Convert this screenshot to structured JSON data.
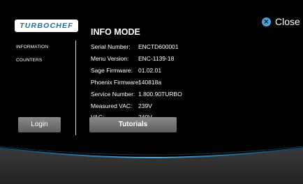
{
  "brand": {
    "logo_text": "TURBOCHEF",
    "accent": "#4aa3d8",
    "logo_color": "#1b6ea3"
  },
  "close": {
    "label": "Close",
    "icon": "close-icon"
  },
  "title": "INFO MODE",
  "sidebar": {
    "items": [
      {
        "label": "INFORMATION"
      },
      {
        "label": "COUNTERS"
      }
    ],
    "login_label": "Login"
  },
  "info": [
    {
      "key": "Serial Number:",
      "value": "ENCTD600001"
    },
    {
      "key": "Menu Version:",
      "value": "ENC-1139-18"
    },
    {
      "key": "Sage Firmware:",
      "value": "01.02.01"
    },
    {
      "key": "Phoenix Firmware:",
      "value": "140818a"
    },
    {
      "key": "Service Number:",
      "value": "1.800.90TURBO"
    },
    {
      "key": "Measured VAC:",
      "value": "239V"
    },
    {
      "key": "VAC:",
      "value": "240V"
    }
  ],
  "tutorials_label": "Tutorials"
}
